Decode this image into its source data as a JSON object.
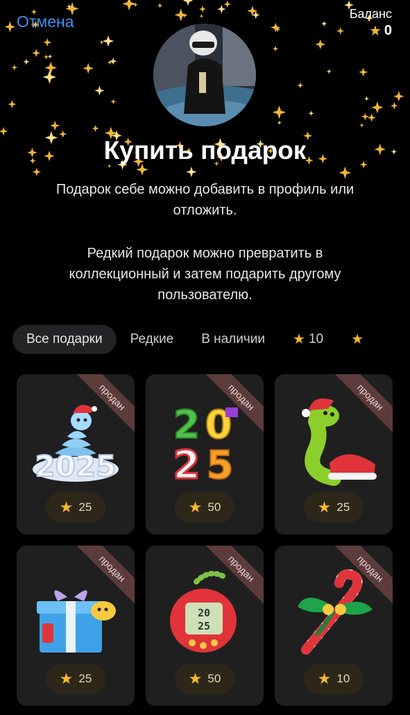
{
  "header": {
    "cancel_label": "Отмена",
    "balance_label": "Баланс",
    "balance_value": "0"
  },
  "title": "Купить подарок",
  "description": {
    "line1": "Подарок себе можно добавить в профиль или отложить.",
    "line2": "Редкий подарок можно превратить в коллекционный и затем подарить другому пользователю."
  },
  "tabs": [
    {
      "label": "Все подарки",
      "active": true
    },
    {
      "label": "Редкие"
    },
    {
      "label": "В наличии"
    },
    {
      "label": "10",
      "icon": "star-icon"
    },
    {
      "label": "",
      "icon": "star-icon"
    }
  ],
  "gifts": [
    {
      "name": "snowman-2025",
      "badge": "продан",
      "price": "25"
    },
    {
      "name": "colorful-2025",
      "badge": "продан",
      "price": "50"
    },
    {
      "name": "snake-santa-hat",
      "badge": "продан",
      "price": "25"
    },
    {
      "name": "gift-box-snake",
      "badge": "продан",
      "price": "25"
    },
    {
      "name": "tamagotchi-2025",
      "badge": "продан",
      "price": "50"
    },
    {
      "name": "candy-cane",
      "badge": "продан",
      "price": "10"
    }
  ],
  "colors": {
    "accent": "#3d8ff0",
    "star": "#f6b82d",
    "badge": "#5c3b3b",
    "card": "#1f1f20"
  }
}
